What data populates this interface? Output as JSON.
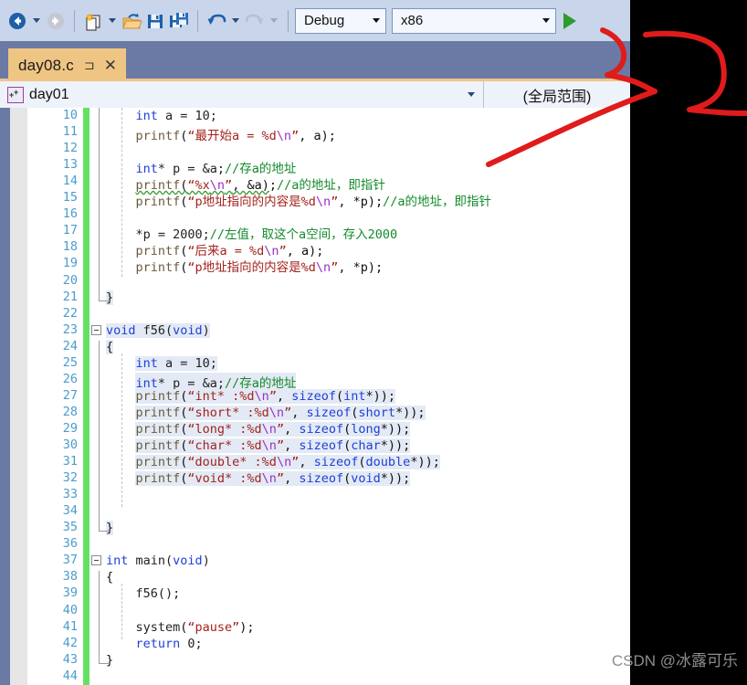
{
  "toolbar": {
    "nav_back": "navigate-backward",
    "nav_forward": "navigate-forward",
    "new_item": "new-item",
    "open_file": "open-file",
    "save": "save",
    "save_all": "save-all",
    "undo": "undo",
    "redo": "redo",
    "config_value": "Debug",
    "platform_value": "x86",
    "run_label": "start-debugging",
    "accent": "#2e9b2e"
  },
  "tab": {
    "title": "day08.c",
    "pin_glyph": "⊐",
    "close_glyph": "✕",
    "color": "#efc583"
  },
  "navbar": {
    "scope_left": "day01",
    "scope_right": "(全局范围)",
    "caret_glyph": "▾"
  },
  "editor": {
    "change_bar_color": "#64e164",
    "first_line": 10,
    "lines": [
      {
        "n": 10,
        "indent": 2,
        "tokens": [
          {
            "t": "int",
            "c": "kw"
          },
          {
            "t": " a = 10;",
            "c": "id"
          }
        ]
      },
      {
        "n": 11,
        "indent": 2,
        "tokens": [
          {
            "t": "printf",
            "c": "fn"
          },
          {
            "t": "(",
            "c": "cn"
          },
          {
            "t": "“最开始a = %d",
            "c": "str"
          },
          {
            "t": "\\n",
            "c": "esc"
          },
          {
            "t": "”",
            "c": "str"
          },
          {
            "t": ", a);",
            "c": "cn"
          }
        ]
      },
      {
        "n": 12,
        "indent": 0,
        "tokens": []
      },
      {
        "n": 13,
        "indent": 2,
        "tokens": [
          {
            "t": "int",
            "c": "kw"
          },
          {
            "t": "* p = &a;",
            "c": "id"
          },
          {
            "t": "//存a的地址",
            "c": "cmt"
          }
        ]
      },
      {
        "n": 14,
        "indent": 2,
        "tokens": [
          {
            "t": "printf",
            "c": "fn sq"
          },
          {
            "t": "(",
            "c": "cn sq"
          },
          {
            "t": "“%x",
            "c": "str sq"
          },
          {
            "t": "\\n",
            "c": "esc sq"
          },
          {
            "t": "”",
            "c": "str sq"
          },
          {
            "t": ", &a)",
            "c": "cn sq"
          },
          {
            "t": ";",
            "c": "cn"
          },
          {
            "t": "//a的地址，即指针",
            "c": "cmt"
          }
        ]
      },
      {
        "n": 15,
        "indent": 2,
        "tokens": [
          {
            "t": "printf",
            "c": "fn"
          },
          {
            "t": "(",
            "c": "cn"
          },
          {
            "t": "“p地址指向的内容是",
            "c": "str"
          },
          {
            "t": "%d",
            "c": "str"
          },
          {
            "t": "\\n",
            "c": "esc"
          },
          {
            "t": "”",
            "c": "str"
          },
          {
            "t": ", *p);",
            "c": "cn"
          },
          {
            "t": "//a的地址，即指针",
            "c": "cmt"
          }
        ]
      },
      {
        "n": 16,
        "indent": 0,
        "tokens": []
      },
      {
        "n": 17,
        "indent": 2,
        "tokens": [
          {
            "t": "*p = 2000;",
            "c": "id"
          },
          {
            "t": "//左值，取这个a空间，存入2000",
            "c": "cmt"
          }
        ]
      },
      {
        "n": 18,
        "indent": 2,
        "tokens": [
          {
            "t": "printf",
            "c": "fn"
          },
          {
            "t": "(",
            "c": "cn"
          },
          {
            "t": "“后来a = %d",
            "c": "str"
          },
          {
            "t": "\\n",
            "c": "esc"
          },
          {
            "t": "”",
            "c": "str"
          },
          {
            "t": ", a);",
            "c": "cn"
          }
        ]
      },
      {
        "n": 19,
        "indent": 2,
        "tokens": [
          {
            "t": "printf",
            "c": "fn"
          },
          {
            "t": "(",
            "c": "cn"
          },
          {
            "t": "“p地址指向的内容是",
            "c": "str"
          },
          {
            "t": "%d",
            "c": "str"
          },
          {
            "t": "\\n",
            "c": "esc"
          },
          {
            "t": "”",
            "c": "str"
          },
          {
            "t": ", *p);",
            "c": "cn"
          }
        ]
      },
      {
        "n": 20,
        "indent": 0,
        "tokens": []
      },
      {
        "n": 21,
        "indent": 0,
        "tokens": [
          {
            "t": "}",
            "c": "cn"
          }
        ]
      },
      {
        "n": 22,
        "indent": 0,
        "tokens": []
      },
      {
        "n": 23,
        "indent": 0,
        "fold": true,
        "tokens": [
          {
            "t": "void",
            "c": "kw"
          },
          {
            "t": " f56(",
            "c": "id"
          },
          {
            "t": "void",
            "c": "kw"
          },
          {
            "t": ")",
            "c": "id"
          }
        ]
      },
      {
        "n": 24,
        "indent": 0,
        "tokens": [
          {
            "t": "{",
            "c": "cn"
          }
        ]
      },
      {
        "n": 25,
        "indent": 2,
        "tokens": [
          {
            "t": "int",
            "c": "kw"
          },
          {
            "t": " a = 10;",
            "c": "id"
          }
        ]
      },
      {
        "n": 26,
        "indent": 2,
        "tokens": [
          {
            "t": "int",
            "c": "kw"
          },
          {
            "t": "* p = &a;",
            "c": "id"
          },
          {
            "t": "//存a的地址",
            "c": "cmt"
          }
        ]
      },
      {
        "n": 27,
        "indent": 2,
        "tokens": [
          {
            "t": "printf",
            "c": "fn"
          },
          {
            "t": "(",
            "c": "cn"
          },
          {
            "t": "“int* :%d",
            "c": "str"
          },
          {
            "t": "\\n",
            "c": "esc"
          },
          {
            "t": "”",
            "c": "str"
          },
          {
            "t": ", ",
            "c": "cn"
          },
          {
            "t": "sizeof",
            "c": "kw"
          },
          {
            "t": "(",
            "c": "cn"
          },
          {
            "t": "int",
            "c": "kw"
          },
          {
            "t": "*));",
            "c": "cn"
          }
        ]
      },
      {
        "n": 28,
        "indent": 2,
        "tokens": [
          {
            "t": "printf",
            "c": "fn"
          },
          {
            "t": "(",
            "c": "cn"
          },
          {
            "t": "“short* :%d",
            "c": "str"
          },
          {
            "t": "\\n",
            "c": "esc"
          },
          {
            "t": "”",
            "c": "str"
          },
          {
            "t": ", ",
            "c": "cn"
          },
          {
            "t": "sizeof",
            "c": "kw"
          },
          {
            "t": "(",
            "c": "cn"
          },
          {
            "t": "short",
            "c": "kw"
          },
          {
            "t": "*));",
            "c": "cn"
          }
        ]
      },
      {
        "n": 29,
        "indent": 2,
        "tokens": [
          {
            "t": "printf",
            "c": "fn"
          },
          {
            "t": "(",
            "c": "cn"
          },
          {
            "t": "“long* :%d",
            "c": "str"
          },
          {
            "t": "\\n",
            "c": "esc"
          },
          {
            "t": "”",
            "c": "str"
          },
          {
            "t": ", ",
            "c": "cn"
          },
          {
            "t": "sizeof",
            "c": "kw"
          },
          {
            "t": "(",
            "c": "cn"
          },
          {
            "t": "long",
            "c": "kw"
          },
          {
            "t": "*));",
            "c": "cn"
          }
        ]
      },
      {
        "n": 30,
        "indent": 2,
        "tokens": [
          {
            "t": "printf",
            "c": "fn"
          },
          {
            "t": "(",
            "c": "cn"
          },
          {
            "t": "“char* :%d",
            "c": "str"
          },
          {
            "t": "\\n",
            "c": "esc"
          },
          {
            "t": "”",
            "c": "str"
          },
          {
            "t": ", ",
            "c": "cn"
          },
          {
            "t": "sizeof",
            "c": "kw"
          },
          {
            "t": "(",
            "c": "cn"
          },
          {
            "t": "char",
            "c": "kw"
          },
          {
            "t": "*));",
            "c": "cn"
          }
        ]
      },
      {
        "n": 31,
        "indent": 2,
        "tokens": [
          {
            "t": "printf",
            "c": "fn"
          },
          {
            "t": "(",
            "c": "cn"
          },
          {
            "t": "“double* :%d",
            "c": "str"
          },
          {
            "t": "\\n",
            "c": "esc"
          },
          {
            "t": "”",
            "c": "str"
          },
          {
            "t": ", ",
            "c": "cn"
          },
          {
            "t": "sizeof",
            "c": "kw"
          },
          {
            "t": "(",
            "c": "cn"
          },
          {
            "t": "double",
            "c": "kw"
          },
          {
            "t": "*));",
            "c": "cn"
          }
        ]
      },
      {
        "n": 32,
        "indent": 2,
        "tokens": [
          {
            "t": "printf",
            "c": "fn"
          },
          {
            "t": "(",
            "c": "cn"
          },
          {
            "t": "“void* :%d",
            "c": "str"
          },
          {
            "t": "\\n",
            "c": "esc"
          },
          {
            "t": "”",
            "c": "str"
          },
          {
            "t": ", ",
            "c": "cn"
          },
          {
            "t": "sizeof",
            "c": "kw"
          },
          {
            "t": "(",
            "c": "cn"
          },
          {
            "t": "void",
            "c": "kw"
          },
          {
            "t": "*));",
            "c": "cn"
          }
        ]
      },
      {
        "n": 33,
        "indent": 0,
        "tokens": []
      },
      {
        "n": 34,
        "indent": 0,
        "tokens": []
      },
      {
        "n": 35,
        "indent": 0,
        "tokens": [
          {
            "t": "}",
            "c": "cn"
          }
        ]
      },
      {
        "n": 36,
        "indent": 0,
        "tokens": []
      },
      {
        "n": 37,
        "indent": 0,
        "fold": true,
        "tokens": [
          {
            "t": "int",
            "c": "kw"
          },
          {
            "t": " main(",
            "c": "id"
          },
          {
            "t": "void",
            "c": "kw"
          },
          {
            "t": ")",
            "c": "id"
          }
        ]
      },
      {
        "n": 38,
        "indent": 0,
        "tokens": [
          {
            "t": "{",
            "c": "cn"
          }
        ]
      },
      {
        "n": 39,
        "indent": 2,
        "tokens": [
          {
            "t": "f56();",
            "c": "id"
          }
        ]
      },
      {
        "n": 40,
        "indent": 0,
        "tokens": []
      },
      {
        "n": 41,
        "indent": 2,
        "tokens": [
          {
            "t": "system",
            "c": "id"
          },
          {
            "t": "(",
            "c": "cn"
          },
          {
            "t": "“pause”",
            "c": "str"
          },
          {
            "t": ");",
            "c": "cn"
          }
        ]
      },
      {
        "n": 42,
        "indent": 2,
        "tokens": [
          {
            "t": "return",
            "c": "kw"
          },
          {
            "t": " 0;",
            "c": "id"
          }
        ]
      },
      {
        "n": 43,
        "indent": 0,
        "tokens": [
          {
            "t": "}",
            "c": "cn"
          }
        ]
      },
      {
        "n": 44,
        "indent": 0,
        "tokens": []
      }
    ]
  },
  "annotation": {
    "color": "#e01b1b",
    "description": "hand-drawn-red-arrow"
  },
  "watermark": {
    "text": "CSDN @冰露可乐"
  }
}
